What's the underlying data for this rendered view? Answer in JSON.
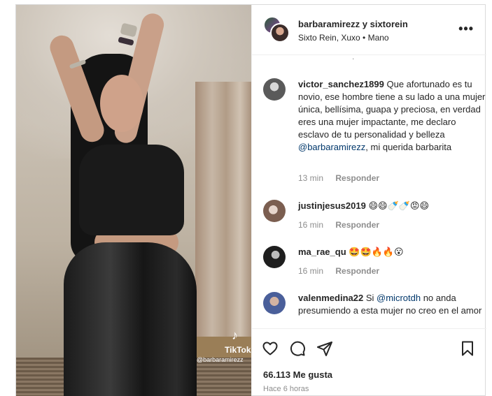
{
  "post": {
    "header": {
      "names": "barbaramirezz y sixtorein",
      "subtitle": "Sixto Rein, Xuxo • Mano",
      "more_icon": "more-horizontal-icon",
      "more_label": "•••"
    },
    "media": {
      "watermark_logo": "♪",
      "watermark_name": "TikTok",
      "watermark_user": "@barbaramirezz"
    },
    "truncated_top": "."
  },
  "comments": [
    {
      "user": "victor_sanchez1899",
      "text": "Que afortunado es tu novio, ese hombre tiene a su lado a una mujer única, bellísima, guapa y preciosa, en verdad eres una mujer impactante, me declaro esclavo de tu personalidad y belleza",
      "mention": "@barbaramirezz",
      "tail": ", mi querida barbarita",
      "time": "13 min",
      "reply": "Responder",
      "avatar_color": "#6b6b6b"
    },
    {
      "user": "justinjesus2019",
      "text": "😄😄🍼🍼😡😄",
      "time": "16 min",
      "reply": "Responder",
      "avatar_color": "#8a6f60"
    },
    {
      "user": "ma_rae_qu",
      "text": "🤩🤩🔥🔥😮",
      "time": "16 min",
      "reply": "Responder",
      "avatar_color": "#2b2b2b"
    },
    {
      "user": "valenmedina22",
      "text": "Si",
      "mention": "@microtdh",
      "tail": "no anda presumiendo a esta mujer no creo en el amor",
      "avatar_color": "#6a7fb8"
    }
  ],
  "actions": {
    "like_icon": "heart-icon",
    "comment_icon": "comment-icon",
    "share_icon": "send-icon",
    "save_icon": "bookmark-icon",
    "likes": "66.113 Me gusta",
    "ago": "Hace 6 horas"
  }
}
